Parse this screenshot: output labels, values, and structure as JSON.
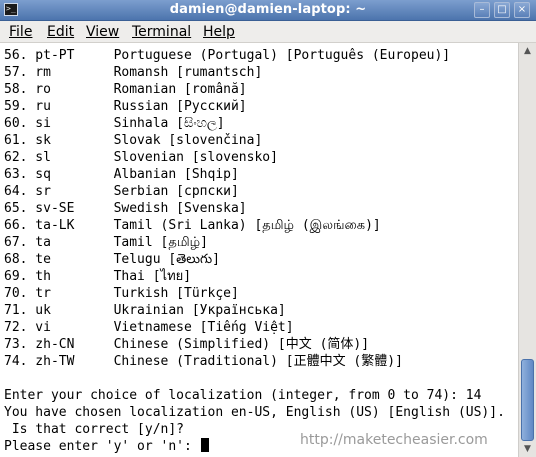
{
  "window": {
    "title": "damien@damien-laptop: ~",
    "terminal_icon": ">_",
    "buttons": {
      "minimize": "–",
      "maximize": "□",
      "close": "×"
    }
  },
  "menu": {
    "file": "File",
    "edit": "Edit",
    "view": "View",
    "terminal": "Terminal",
    "help": "Help"
  },
  "locales": [
    "56. pt-PT     Portuguese (Portugal) [Português (Europeu)]",
    "57. rm        Romansh [rumantsch]",
    "58. ro        Romanian [română]",
    "59. ru        Russian [Русский]",
    "60. si        Sinhala [සිංහල]",
    "61. sk        Slovak [slovenčina]",
    "62. sl        Slovenian [slovensko]",
    "63. sq        Albanian [Shqip]",
    "64. sr        Serbian [српски]",
    "65. sv-SE     Swedish [Svenska]",
    "66. ta-LK     Tamil (Sri Lanka) [தமிழ் (இலங்கை)]",
    "67. ta        Tamil [தமிழ்]",
    "68. te        Telugu [తెలుగు]",
    "69. th        Thai [ไทย]",
    "70. tr        Turkish [Türkçe]",
    "71. uk        Ukrainian [Українська]",
    "72. vi        Vietnamese [Tiếng Việt]",
    "73. zh-CN     Chinese (Simplified) [中文 (简体)]",
    "74. zh-TW     Chinese (Traditional) [正體中文 (繁體)]"
  ],
  "prompt": {
    "choice": "Enter your choice of localization (integer, from 0 to 74): 14",
    "chosen": "You have chosen localization en-US, English (US) [English (US)].",
    "confirm": " Is that correct [y/n]?",
    "enter": "Please enter 'y' or 'n': "
  },
  "watermark": "http://maketecheasier.com",
  "colors": {
    "titlebar": "#5b7fb6",
    "menubar": "#eeedeb",
    "terminal_bg": "#ffffff",
    "terminal_fg": "#000000",
    "scroll_thumb": "#6f95cc"
  }
}
